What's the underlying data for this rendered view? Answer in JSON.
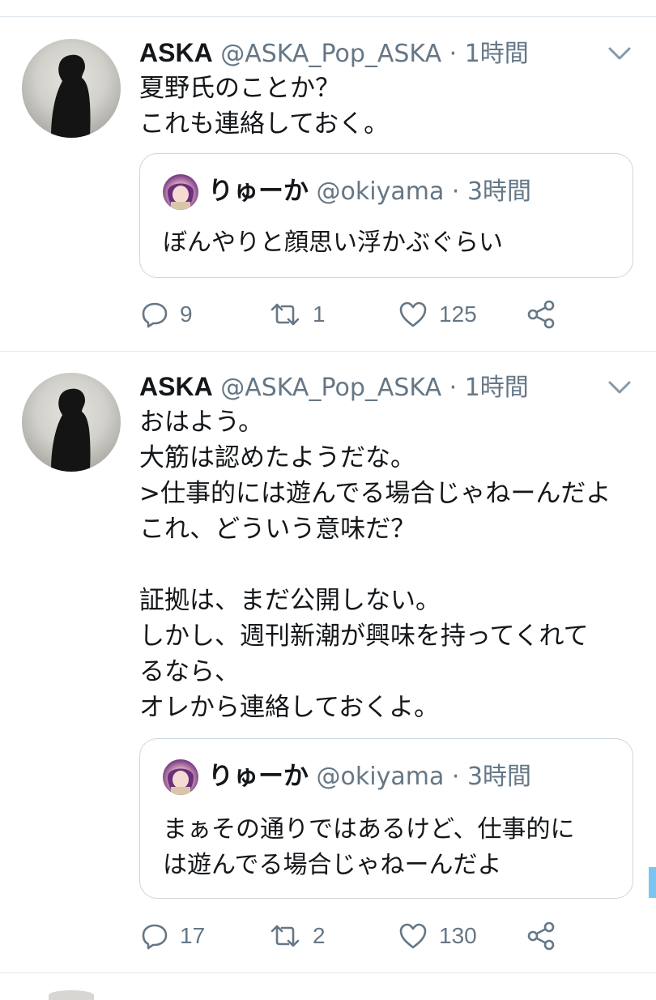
{
  "tweets": [
    {
      "author_name": "ASKA",
      "handle_time": "@ASKA_Pop_ASKA · 1時間",
      "text": "夏野氏のことか？\nこれも連絡しておく。",
      "quote": {
        "author_name": "りゅーか",
        "handle_time": "@okiyama · 3時間",
        "text": "ぼんやりと顔思い浮かぶぐらい"
      },
      "replies": "9",
      "retweets": "1",
      "likes": "125"
    },
    {
      "author_name": "ASKA",
      "handle_time": "@ASKA_Pop_ASKA · 1時間",
      "text": "おはよう。\n大筋は認めたようだな。\n>仕事的には遊んでる場合じゃねーんだよ\nこれ、どういう意味だ？\n\n証拠は、まだ公開しない。\nしかし、週刊新潮が興味を持ってくれて\nるなら、\nオレから連絡しておくよ。",
      "quote": {
        "author_name": "りゅーか",
        "handle_time": "@okiyama · 3時間",
        "text": "まぁその通りではあるけど、仕事的に\nは遊んでる場合じゃねーんだよ"
      },
      "replies": "17",
      "retweets": "2",
      "likes": "130"
    }
  ],
  "icons": {
    "reply": "reply-icon",
    "retweet": "retweet-icon",
    "like": "heart-icon",
    "share": "share-icon",
    "menu": "chevron-down-icon"
  },
  "colors": {
    "text": "#14171a",
    "secondary": "#657786",
    "divider": "#e1e8ed",
    "quote_border": "#ccd6dd",
    "scroll_indicator": "#7cc4f2"
  }
}
